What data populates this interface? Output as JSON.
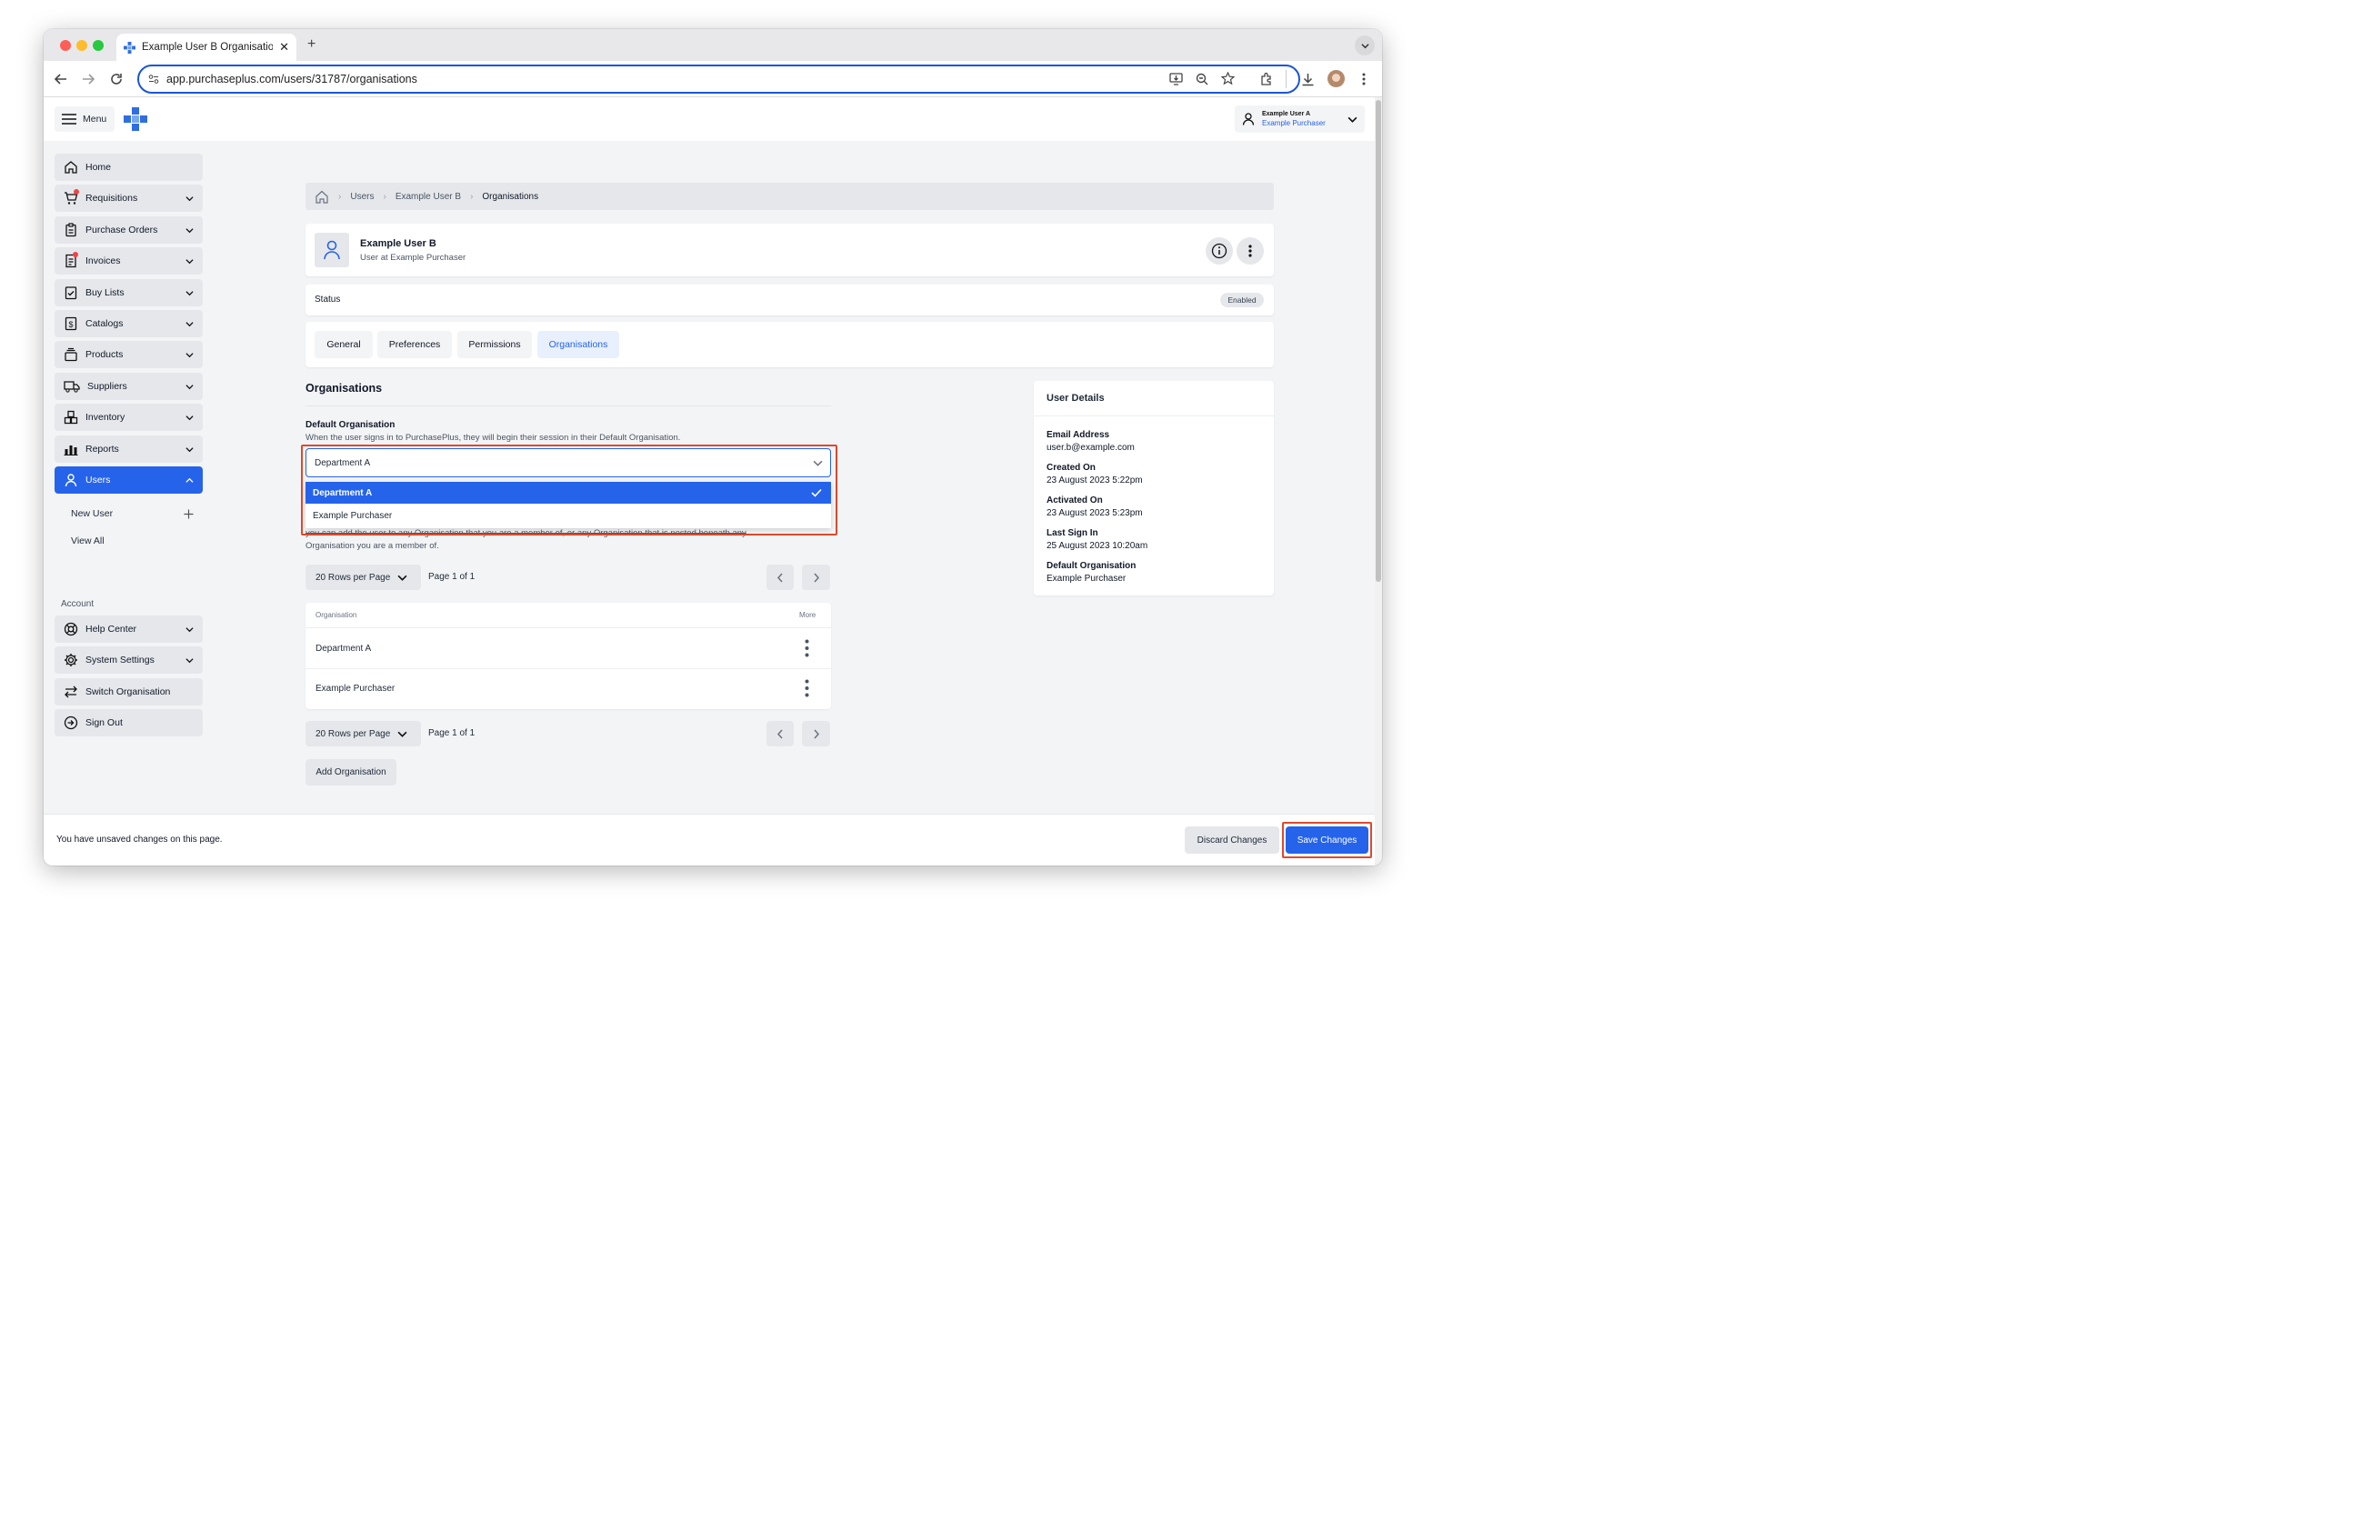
{
  "browser": {
    "tab_title": "Example User B Organisations",
    "url": "app.purchaseplus.com/users/31787/organisations"
  },
  "app": {
    "menu_label": "Menu",
    "account": {
      "user_name": "Example User A",
      "org_name": "Example Purchaser"
    }
  },
  "sidebar": {
    "items": [
      {
        "label": "Home"
      },
      {
        "label": "Requisitions"
      },
      {
        "label": "Purchase Orders"
      },
      {
        "label": "Invoices"
      },
      {
        "label": "Buy Lists"
      },
      {
        "label": "Catalogs"
      },
      {
        "label": "Products"
      },
      {
        "label": "Suppliers"
      },
      {
        "label": "Inventory"
      },
      {
        "label": "Reports"
      },
      {
        "label": "Users"
      }
    ],
    "users_sub": {
      "new_user": "New User",
      "view_all": "View All"
    },
    "account_heading": "Account",
    "account_items": [
      {
        "label": "Help Center"
      },
      {
        "label": "System Settings"
      },
      {
        "label": "Switch Organisation"
      },
      {
        "label": "Sign Out"
      }
    ]
  },
  "breadcrumb": {
    "items": [
      "Users",
      "Example User B",
      "Organisations"
    ]
  },
  "user_header": {
    "name": "Example User B",
    "subtitle": "User at Example Purchaser"
  },
  "status": {
    "label": "Status",
    "badge": "Enabled"
  },
  "tabs": [
    {
      "label": "General"
    },
    {
      "label": "Preferences"
    },
    {
      "label": "Permissions"
    },
    {
      "label": "Organisations",
      "active": true
    }
  ],
  "organisations": {
    "heading": "Organisations",
    "default_org_label": "Default Organisation",
    "default_org_help": "When the user signs in to PurchasePlus, they will begin their session in their Default Organisation.",
    "select_value": "Department A",
    "options": [
      "Department A",
      "Example Purchaser"
    ],
    "selected_option": "Department A",
    "list_help_line1": "you can add the user to any Organisation that you are a member of, or any Organisation that is nested beneath any",
    "list_help_line2": "Organisation you are a member of.",
    "rows_per_page": "20 Rows per Page",
    "page_info": "Page 1 of 1",
    "table_headers": {
      "organisation": "Organisation",
      "more": "More"
    },
    "rows": [
      "Department A",
      "Example Purchaser"
    ],
    "add_button": "Add Organisation"
  },
  "user_details": {
    "title": "User Details",
    "fields": [
      {
        "label": "Email Address",
        "value": "user.b@example.com"
      },
      {
        "label": "Created On",
        "value": "23 August 2023 5:22pm"
      },
      {
        "label": "Activated On",
        "value": "23 August 2023 5:23pm"
      },
      {
        "label": "Last Sign In",
        "value": "25 August 2023 10:20am"
      },
      {
        "label": "Default Organisation",
        "value": "Example Purchaser"
      }
    ]
  },
  "footer": {
    "unsaved_text": "You have unsaved changes on this page.",
    "discard_label": "Discard Changes",
    "save_label": "Save Changes"
  },
  "colors": {
    "accent": "#2563eb",
    "highlight_box": "#e0492d",
    "logo_blue": "#2f6ee0"
  }
}
